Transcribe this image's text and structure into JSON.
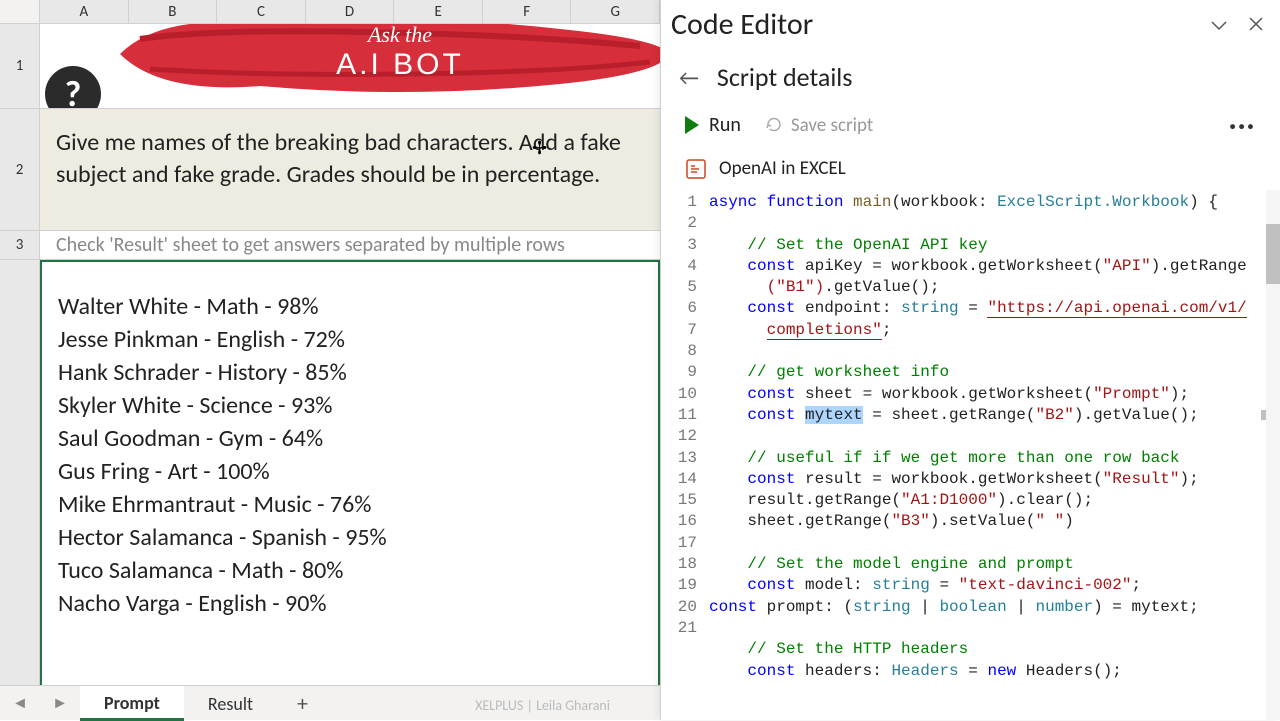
{
  "columns": [
    "A",
    "B",
    "C",
    "D",
    "E",
    "F",
    "G"
  ],
  "banner": {
    "line1": "Ask the",
    "line2": "A.I BOT"
  },
  "prompt_text": "Give me names of the breaking bad characters. Add a fake subject and fake grade. Grades should be in percentage.",
  "hint": "Check 'Result' sheet to get answers separated by multiple rows",
  "results": [
    "Walter White - Math - 98%",
    "Jesse Pinkman - English - 72%",
    "Hank Schrader - History - 85%",
    "Skyler White - Science - 93%",
    "Saul Goodman - Gym - 64%",
    "Gus Fring - Art - 100%",
    "Mike Ehrmantraut - Music - 76%",
    "Hector Salamanca - Spanish - 95%",
    "Tuco Salamanca - Math - 80%",
    "Nacho Varga - English - 90%"
  ],
  "tabs": {
    "active": "Prompt",
    "other": "Result"
  },
  "footer_brand": "XELPLUS | Leila Gharani",
  "panel": {
    "title": "Code Editor",
    "subtitle": "Script details",
    "run": "Run",
    "save": "Save script",
    "script_name": "OpenAI in EXCEL"
  },
  "code": {
    "async": "async",
    "function": "function",
    "main": "main",
    "workbook": "(workbook: ",
    "wbType": "ExcelScript.Workbook",
    "brace": ") {",
    "c1": "// Set the OpenAI API key",
    "const": "const",
    "apiKey": " apiKey = workbook.getWorksheet(",
    "apiStr": "\"API\"",
    "getRange": ").getRange",
    "b1": "(\"B1\")",
    "getVal": ".getValue();",
    "endpoint": " endpoint: ",
    "string": "string",
    "eq": " = ",
    "url": "\"https://api.openai.com/v1/",
    "url2": "completions\"",
    "semi": ";",
    "c2": "// get worksheet info",
    "sheet": " sheet = workbook.getWorksheet(",
    "promptStr": "\"Prompt\"",
    "closeParen": ");",
    "mytext": "mytext",
    "mytextRest": " = sheet.getRange(",
    "b2": "\"B2\"",
    "getVal2": ").getValue();",
    "c3": "// useful if if we get more than one row back",
    "result": " result = workbook.getWorksheet(",
    "resultStr": "\"Result\"",
    "clearLine": "result.getRange(",
    "a1d1000": "\"A1:D1000\"",
    "clear": ").clear();",
    "setLine": "sheet.getRange(",
    "b3": "\"B3\"",
    "setVal": ").setValue(",
    "space": "\" \"",
    "closeP": ")",
    "c4": "// Set the model engine and prompt",
    "model": " model: ",
    "modelVal": "\"text-davinci-002\"",
    "promptLine": " prompt: (",
    "union": " | ",
    "bool": "boolean",
    "numberT": "number",
    "mytextEnd": ") = mytext;",
    "c5": "// Set the HTTP headers",
    "headers": " headers: ",
    "headersT": "Headers",
    "new": "new",
    "headersCall": " Headers();"
  }
}
